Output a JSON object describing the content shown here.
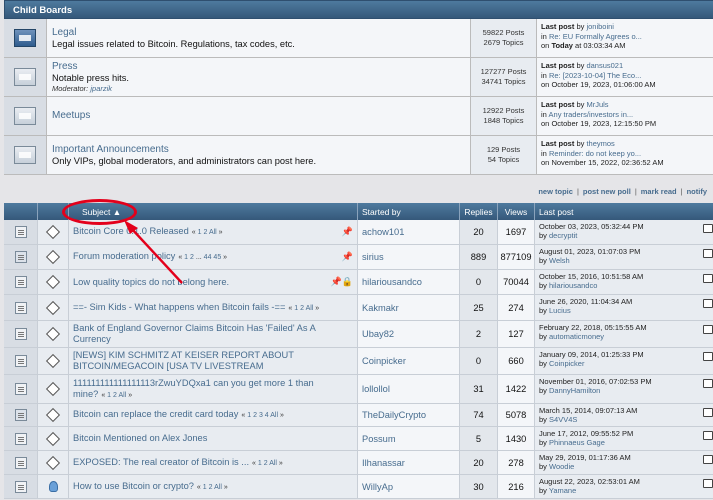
{
  "child_boards": {
    "title": "Child Boards",
    "boards": [
      {
        "name": "Legal",
        "desc": "Legal issues related to Bitcoin. Regulations, tax codes, etc.",
        "moderator_label": "",
        "moderator": "",
        "posts": "59822 Posts",
        "topics": "2679 Topics",
        "lp_label": "Last post",
        "lp_by": "by",
        "lp_user": "joniboini",
        "lp_in": "in",
        "lp_topic": "Re: EU Formally Agrees o...",
        "lp_on": "on",
        "lp_date": "Today",
        "lp_time": " at 03:03:34 AM",
        "new": true
      },
      {
        "name": "Press",
        "desc": "Notable press hits.",
        "moderator_label": "Moderator:",
        "moderator": "jparzik",
        "posts": "127277 Posts",
        "topics": "34741 Topics",
        "lp_label": "Last post",
        "lp_by": "by",
        "lp_user": "dansus021",
        "lp_in": "in",
        "lp_topic": "Re: [2023-10-04] The Eco...",
        "lp_on": "on",
        "lp_date": "October 19, 2023, 01:06:00 AM",
        "lp_time": "",
        "new": false
      },
      {
        "name": "Meetups",
        "desc": "",
        "moderator_label": "",
        "moderator": "",
        "posts": "12922 Posts",
        "topics": "1848 Topics",
        "lp_label": "Last post",
        "lp_by": "by",
        "lp_user": "MrJuls",
        "lp_in": "in",
        "lp_topic": "Any traders/investors in...",
        "lp_on": "on",
        "lp_date": "October 19, 2023, 12:15:50 PM",
        "lp_time": "",
        "new": false
      },
      {
        "name": "Important Announcements",
        "desc": "Only VIPs, global moderators, and administrators can post here.",
        "moderator_label": "",
        "moderator": "",
        "posts": "129 Posts",
        "topics": "54 Topics",
        "lp_label": "Last post",
        "lp_by": "by",
        "lp_user": "theymos",
        "lp_in": "in",
        "lp_topic": "Reminder: do not keep yo...",
        "lp_on": "on",
        "lp_date": "November 15, 2022, 02:36:52 AM",
        "lp_time": "",
        "new": false
      }
    ]
  },
  "links_bar": {
    "new_topic": "new topic",
    "new_poll": "post new poll",
    "mark_read": "mark read",
    "notify": "notify"
  },
  "topic_table": {
    "headers": {
      "subject": "Subject",
      "started_by": "Started by",
      "replies": "Replies",
      "views": "Views",
      "last_post": "Last post"
    },
    "topics": [
      {
        "subject": "Bitcoin Core 0.1.0 Released",
        "pages": [
          "1",
          "2",
          "All"
        ],
        "pinned": true,
        "locked": false,
        "started_by": "achow101",
        "replies": "20",
        "views": "1697",
        "lp_date": "October 03, 2023, 05:32:44 PM",
        "lp_by": "by",
        "lp_user": "decryptit",
        "icon": "topic"
      },
      {
        "subject": "Forum moderation policy",
        "pages": [
          "1",
          "2",
          "...",
          "44",
          "45"
        ],
        "pinned": true,
        "locked": false,
        "started_by": "sirius",
        "replies": "889",
        "views": "877109",
        "lp_date": "August 01, 2023, 01:07:03 PM",
        "lp_by": "by",
        "lp_user": "Welsh",
        "icon": "hot"
      },
      {
        "subject": "Low quality topics do not belong here.",
        "pages": [],
        "pinned": true,
        "locked": true,
        "started_by": "hilariousandco",
        "replies": "0",
        "views": "70044",
        "lp_date": "October 15, 2016, 10:51:58 AM",
        "lp_by": "by",
        "lp_user": "hilariousandco",
        "icon": "topic"
      },
      {
        "subject": "==- Sim Kids - What happens when Bitcoin fails -==",
        "pages": [
          "1",
          "2",
          "All"
        ],
        "pinned": false,
        "locked": false,
        "started_by": "Kakmakr",
        "replies": "25",
        "views": "274",
        "lp_date": "June 26, 2020, 11:04:34 AM",
        "lp_by": "by",
        "lp_user": "Lucius",
        "icon": "topic"
      },
      {
        "subject": "Bank of England Governor Claims Bitcoin Has 'Failed' As A Currency",
        "pages": [],
        "pinned": false,
        "locked": false,
        "started_by": "Ubay82",
        "replies": "2",
        "views": "127",
        "lp_date": "February 22, 2018, 05:15:55 AM",
        "lp_by": "by",
        "lp_user": "automaticmoney",
        "icon": "topic"
      },
      {
        "subject": "[NEWS] KIM SCHMITZ AT KEISER REPORT ABOUT BITCOIN/MEGACOIN [USA TV LIVESTREAM",
        "pages": [],
        "pinned": false,
        "locked": false,
        "started_by": "Coinpicker",
        "replies": "0",
        "views": "660",
        "lp_date": "January 09, 2014, 01:25:33 PM",
        "lp_by": "by",
        "lp_user": "Coinpicker",
        "icon": "topic"
      },
      {
        "subject": "111111111111111113rZwuYDQxa1 can you get more 1 than mine?",
        "pages": [
          "1",
          "2",
          "All"
        ],
        "pinned": false,
        "locked": false,
        "started_by": "lollollol",
        "replies": "31",
        "views": "1422",
        "lp_date": "November 01, 2016, 07:02:53 PM",
        "lp_by": "by",
        "lp_user": "DannyHamilton",
        "icon": "topic"
      },
      {
        "subject": "Bitcoin can replace the credit card today",
        "pages": [
          "1",
          "2",
          "3",
          "4",
          "All"
        ],
        "pinned": false,
        "locked": false,
        "started_by": "TheDailyCrypto",
        "replies": "74",
        "views": "5078",
        "lp_date": "March 15, 2014, 09:07:13 AM",
        "lp_by": "by",
        "lp_user": "S4VV4S",
        "icon": "hot"
      },
      {
        "subject": "Bitcoin Mentioned on Alex Jones",
        "pages": [],
        "pinned": false,
        "locked": false,
        "started_by": "Possum",
        "replies": "5",
        "views": "1430",
        "lp_date": "June 17, 2012, 09:55:52 PM",
        "lp_by": "by",
        "lp_user": "Phinnaeus Gage",
        "icon": "topic"
      },
      {
        "subject": "EXPOSED: The real creator of Bitcoin is ...",
        "pages": [
          "1",
          "2",
          "All"
        ],
        "pinned": false,
        "locked": false,
        "started_by": "Ilhanassar",
        "replies": "20",
        "views": "278",
        "lp_date": "May 29, 2019, 01:17:36 AM",
        "lp_by": "by",
        "lp_user": "Woodie",
        "icon": "topic"
      },
      {
        "subject": "How to use Bitcoin or crypto?",
        "pages": [
          "1",
          "2",
          "All"
        ],
        "pinned": false,
        "locked": false,
        "started_by": "WillyAp",
        "replies": "30",
        "views": "216",
        "lp_date": "August 22, 2023, 02:53:01 AM",
        "lp_by": "by",
        "lp_user": "Yamane",
        "icon": "topic",
        "bulb": true
      }
    ]
  },
  "colors": {
    "accent": "#476C8E",
    "header_bg": "#3F6587",
    "callout": "#E3001B"
  }
}
